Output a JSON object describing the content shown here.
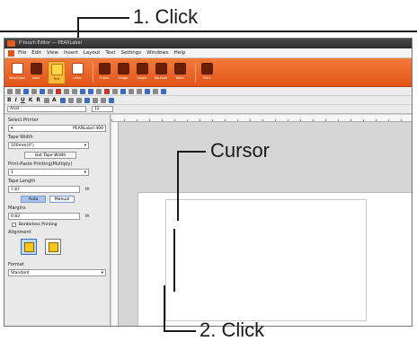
{
  "callouts": {
    "click1": "1. Click",
    "cursor": "Cursor",
    "click2": "2. Click"
  },
  "window": {
    "title": "P-touch Editor — PEARLabel"
  },
  "menu": [
    "File",
    "Edit",
    "View",
    "Insert",
    "Layout",
    "Text",
    "Settings",
    "Windows",
    "Help"
  ],
  "ribbon": [
    {
      "label": "New/Open",
      "icon": "new-icon"
    },
    {
      "label": "Save",
      "icon": "save-icon"
    },
    {
      "label": "Text",
      "icon": "text-icon",
      "active": true
    },
    {
      "label": "Undo",
      "icon": "undo-icon"
    },
    {
      "label": "Frame",
      "icon": "frame-icon"
    },
    {
      "label": "Image",
      "icon": "image-icon"
    },
    {
      "label": "Shape",
      "icon": "shape-icon"
    },
    {
      "label": "Barcode",
      "icon": "barcode-icon"
    },
    {
      "label": "Table",
      "icon": "table-icon"
    },
    {
      "label": "Print",
      "icon": "print-icon"
    }
  ],
  "fontbar": {
    "font": "Arial",
    "size": "12"
  },
  "panel": {
    "select_printer": "Select Printer",
    "printer": "PEARLabel 400",
    "tape_width": "Tape Width",
    "tape_width_value": "100mm(4\")",
    "get_tape_width": "Get Tape Width",
    "print_paste": "Print-Paste Printing(Multiply)",
    "print_paste_value": "1",
    "tape_length": "Tape Length",
    "tape_length_value": "7.87",
    "unit": "in",
    "auto": "Auto",
    "manual": "Manual",
    "margins": "Margins",
    "margins_value": "0.83",
    "borderless": "Borderless Printing",
    "alignment": "Alignment",
    "format": "Format",
    "format_value": "Standard"
  },
  "colors": {
    "ribbon_top": "#f47a3a",
    "ribbon_bottom": "#e2541a",
    "active_tool": "#fbb73a",
    "selected_radio": "#a9c4ef"
  }
}
